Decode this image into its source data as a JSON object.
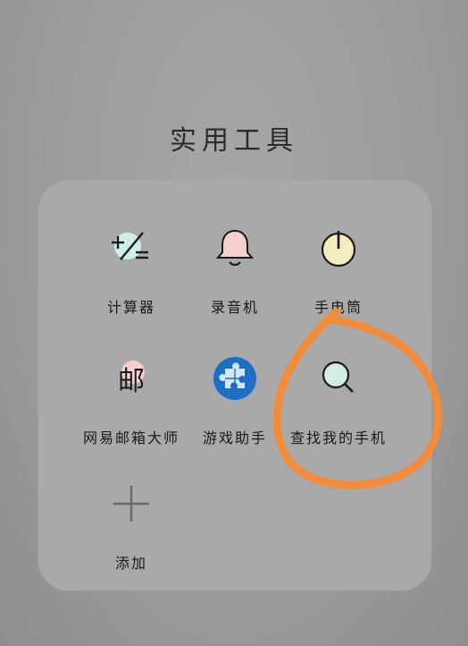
{
  "folder": {
    "title": "实用工具"
  },
  "apps": [
    {
      "label": "计算器",
      "icon": "calculator-icon"
    },
    {
      "label": "录音机",
      "icon": "bell-icon"
    },
    {
      "label": "手电筒",
      "icon": "power-icon"
    },
    {
      "label": "网易邮箱大师",
      "icon": "mail-icon",
      "icon_text": "邮"
    },
    {
      "label": "游戏助手",
      "icon": "puzzle-icon"
    },
    {
      "label": "查找我的手机",
      "icon": "magnifier-icon"
    },
    {
      "label": "添加",
      "icon": "plus-icon"
    }
  ],
  "colors": {
    "background": "#9c9c9c",
    "panel": "#a9a9a9",
    "annotation": "#f08c3c",
    "game_icon": "#1d6fc4"
  }
}
